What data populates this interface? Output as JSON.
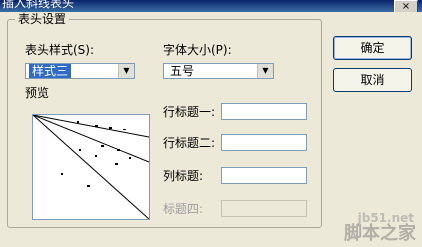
{
  "window": {
    "title": "插入斜线表头",
    "close_glyph": "×"
  },
  "group": {
    "legend": "表头设置"
  },
  "style": {
    "label": "表头样式(S):",
    "value": "样式三",
    "arrow_glyph": "▼"
  },
  "font": {
    "label": "字体大小(P):",
    "value": "五号",
    "arrow_glyph": "▼"
  },
  "preview": {
    "label": "预览"
  },
  "fields": {
    "row1": {
      "label": "行标题一:",
      "value": ""
    },
    "row2": {
      "label": "行标题二:",
      "value": ""
    },
    "col": {
      "label": "列标题:",
      "value": ""
    },
    "title4": {
      "label": "标题四:",
      "value": ""
    }
  },
  "buttons": {
    "ok": "确定",
    "cancel": "取消"
  },
  "watermark": {
    "site": "jb51.net",
    "brand": "脚本之家"
  }
}
